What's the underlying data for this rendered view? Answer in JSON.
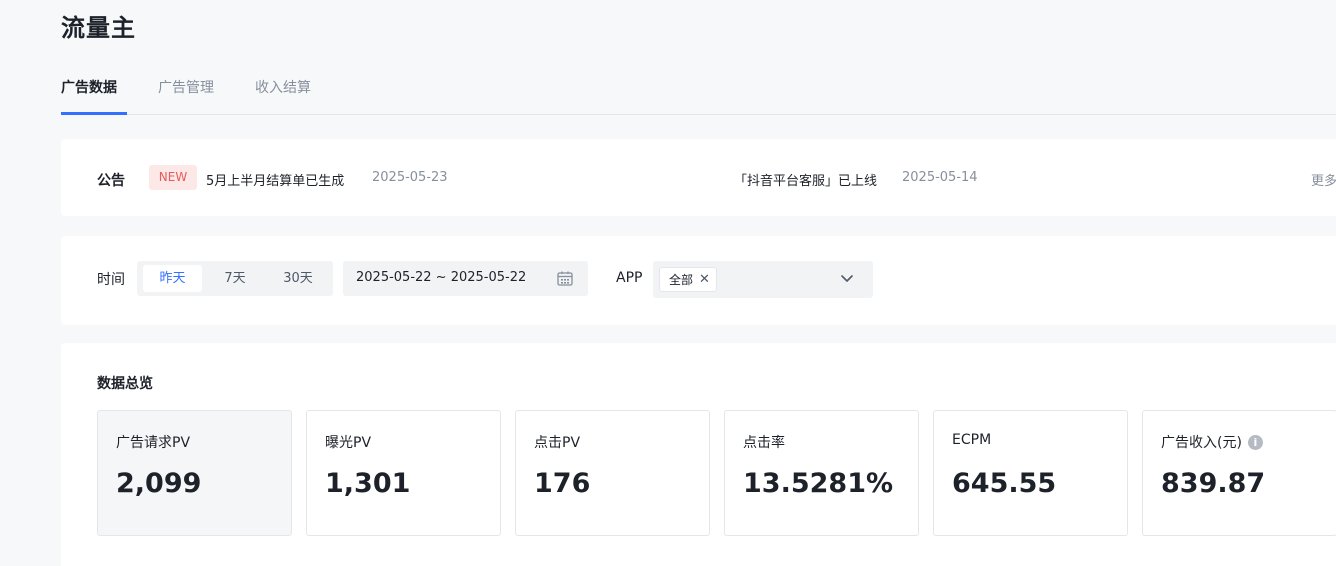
{
  "app": {
    "title": "流量主"
  },
  "tabs": [
    {
      "label": "广告数据",
      "active": true
    },
    {
      "label": "广告管理",
      "active": false
    },
    {
      "label": "收入结算",
      "active": false
    }
  ],
  "notice": {
    "label": "公告",
    "badge": "NEW",
    "items": [
      {
        "text": "5月上半月结算单已生成",
        "date": "2025-05-23"
      },
      {
        "text": "「抖音平台客服」已上线",
        "date": "2025-05-14"
      }
    ],
    "more": "更多"
  },
  "filter": {
    "time_label": "时间",
    "ranges": [
      {
        "label": "昨天",
        "active": true
      },
      {
        "label": "7天",
        "active": false
      },
      {
        "label": "30天",
        "active": false
      }
    ],
    "date_range": "2025-05-22 ~ 2025-05-22",
    "app_label": "APP",
    "app_tag": "全部"
  },
  "overview": {
    "title": "数据总览",
    "metrics": [
      {
        "label": "广告请求PV",
        "value": "2,099",
        "selected": true
      },
      {
        "label": "曝光PV",
        "value": "1,301"
      },
      {
        "label": "点击PV",
        "value": "176"
      },
      {
        "label": "点击率",
        "value": "13.5281%"
      },
      {
        "label": "ECPM",
        "value": "645.55"
      },
      {
        "label": "广告收入(元)",
        "value": "839.87",
        "info": true
      }
    ]
  },
  "colors": {
    "accent": "#3370ff",
    "badge_bg": "#fde8e8",
    "badge_text": "#e95a5a",
    "text_primary": "#1d2129",
    "text_secondary": "#86909c"
  },
  "icons": {
    "calendar": "calendar-icon",
    "close": "close-icon",
    "chevron": "chevron-down-icon",
    "info": "info-icon"
  }
}
